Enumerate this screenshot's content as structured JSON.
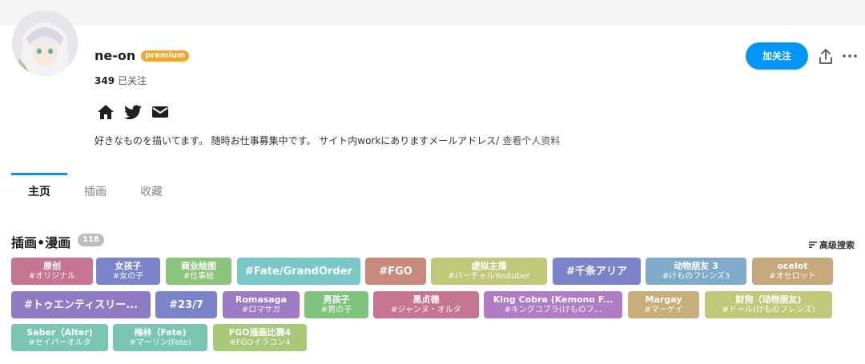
{
  "profile": {
    "username": "ne-on",
    "premium_badge": "premium",
    "following_count": "349",
    "following_label": "已关注",
    "bio": "好きなものを描いてます。 随時お仕事募集中です。 サイト内workにありますメールアドレス/",
    "view_profile": "查看个人资料"
  },
  "actions": {
    "follow_label": "加关注"
  },
  "social": [
    "home-icon",
    "twitter-icon",
    "mail-icon"
  ],
  "tabs": [
    {
      "label": "主页",
      "active": true
    },
    {
      "label": "插画",
      "active": false
    },
    {
      "label": "收藏",
      "active": false
    }
  ],
  "section": {
    "title": "插画•漫画",
    "count": "118",
    "advanced_search": "高级搜索"
  },
  "tags": [
    {
      "name": "原创",
      "translation": "#オリジナル",
      "color": "#c57492"
    },
    {
      "name": "女孩子",
      "translation": "#女の子",
      "color": "#7b84c8"
    },
    {
      "name": "商业绘图",
      "translation": "#仕事絵",
      "color": "#8cc47b"
    },
    {
      "name": "#Fate/GrandOrder",
      "translation": "",
      "color": "#79c7c7"
    },
    {
      "name": "#FGO",
      "translation": "",
      "color": "#c98a7e"
    },
    {
      "name": "虚拟主播",
      "translation": "#バーチャルYoutuber",
      "color": "#c2c87a"
    },
    {
      "name": "#千条アリア",
      "translation": "",
      "color": "#7b84c8"
    },
    {
      "name": "动物朋友 3",
      "translation": "#けものフレンズ3",
      "color": "#7fabc8"
    },
    {
      "name": "ocelot",
      "translation": "#オセロット",
      "color": "#c7a87b"
    },
    {
      "name": "#トゥエンティスリー...",
      "translation": "",
      "color": "#8f7bc4"
    },
    {
      "name": "#23/7",
      "translation": "",
      "color": "#7b84c8"
    },
    {
      "name": "Romasaga",
      "translation": "#ロマサガ",
      "color": "#9c7bc4"
    },
    {
      "name": "男孩子",
      "translation": "#男の子",
      "color": "#7fc37f"
    },
    {
      "name": "黑贞德",
      "translation": "#ジャンヌ・オルタ",
      "color": "#c57492"
    },
    {
      "name": "King Cobra (Kemono F...",
      "translation": "#キングコブラ(けものフ...",
      "color": "#b07cc4"
    },
    {
      "name": "Margay",
      "translation": "#マーゲイ",
      "color": "#c7ae7b"
    },
    {
      "name": "财狗（动物朋友)",
      "translation": "#ドール(けものフレンズ)",
      "color": "#c2c87a"
    },
    {
      "name": "Saber（Alter)",
      "translation": "#セイバーオルタ",
      "color": "#79c7b3"
    },
    {
      "name": "梅林（Fate)",
      "translation": "#マーリン(Fate)",
      "color": "#79c7b3"
    },
    {
      "name": "FGO插画比赛4",
      "translation": "#FGOイラコン4",
      "color": "#a9c87a"
    }
  ]
}
